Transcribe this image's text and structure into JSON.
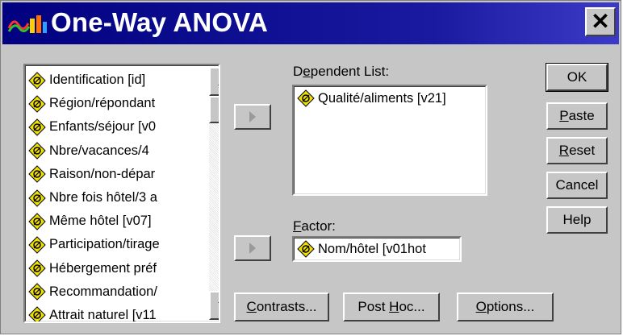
{
  "window": {
    "title": "One-Way ANOVA",
    "close_label": "✕"
  },
  "variables": [
    {
      "label": "Identification [id]"
    },
    {
      "label": "Région/répondant"
    },
    {
      "label": "Enfants/séjour [v0"
    },
    {
      "label": "Nbre/vacances/4"
    },
    {
      "label": "Raison/non-dépar"
    },
    {
      "label": "Nbre fois hôtel/3 a"
    },
    {
      "label": "Même hôtel [v07]"
    },
    {
      "label": "Participation/tirage"
    },
    {
      "label": "Hébergement préf"
    },
    {
      "label": "Recommandation/"
    },
    {
      "label": "Attrait naturel [v11"
    }
  ],
  "dependent": {
    "label_pre": "D",
    "label_ul": "e",
    "label_post": "pendent List:",
    "items": [
      {
        "label": "Qualité/aliments [v21]"
      }
    ]
  },
  "factor": {
    "label_ul": "F",
    "label_post": "actor:",
    "value": "Nom/hôtel [v01hot"
  },
  "buttons": {
    "ok": "OK",
    "paste_ul": "P",
    "paste_rest": "aste",
    "reset_ul": "R",
    "reset_rest": "eset",
    "cancel": "Cancel",
    "help": "Help",
    "contrasts_ul": "C",
    "contrasts_rest": "ontrasts...",
    "posthoc_pre": "Post ",
    "posthoc_ul": "H",
    "posthoc_rest": "oc...",
    "options_ul": "O",
    "options_rest": "ptions..."
  },
  "colors": {
    "titlebar": "#000080",
    "face": "#c6c6c6",
    "nominal_icon": "#f0e000"
  }
}
